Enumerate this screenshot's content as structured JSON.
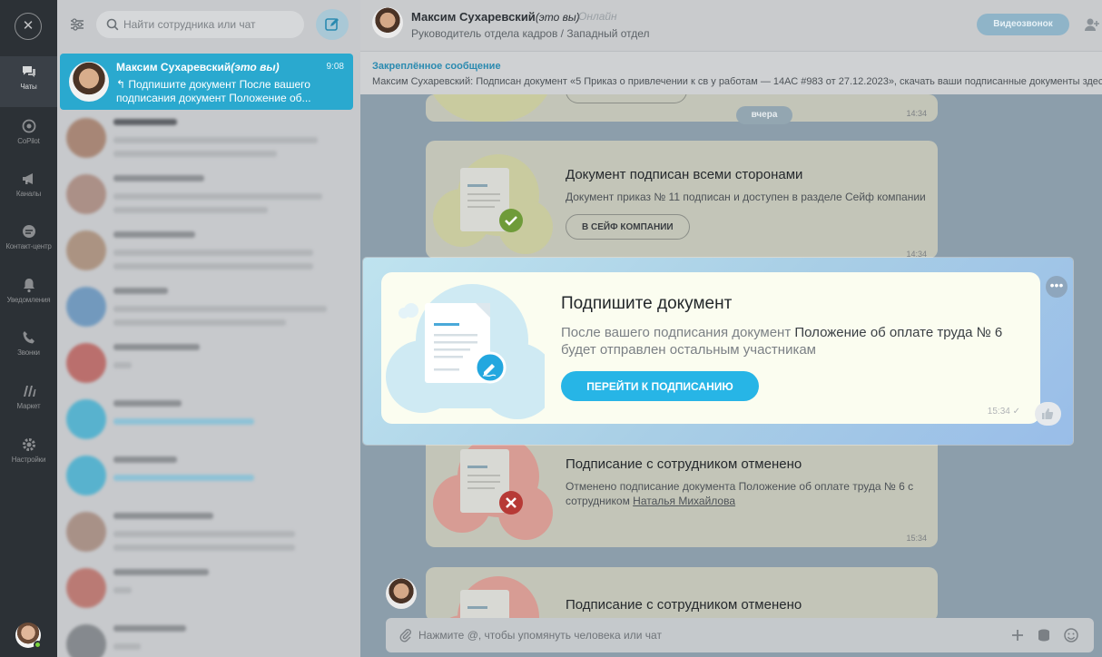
{
  "rail": {
    "items": [
      {
        "label": "Чаты",
        "icon": "chat-icon"
      },
      {
        "label": "CoPilot",
        "icon": "copilot-icon"
      },
      {
        "label": "Каналы",
        "icon": "megaphone-icon"
      },
      {
        "label": "Контакт-центр",
        "icon": "contact-center-icon"
      },
      {
        "label": "Уведомления",
        "icon": "bell-icon"
      },
      {
        "label": "Звонки",
        "icon": "phone-icon"
      },
      {
        "label": "Маркет",
        "icon": "market-icon"
      },
      {
        "label": "Настройки",
        "icon": "gear-icon"
      }
    ]
  },
  "list": {
    "search_placeholder": "Найти сотрудника или чат",
    "active_chat": {
      "name": "Максим Сухаревский",
      "name_suffix": "(это вы)",
      "time": "9:08",
      "preview": "↰ Подпишите документ После вашего подписания документ Положение об..."
    }
  },
  "header": {
    "name": "Максим Сухаревский",
    "name_suffix": "(это вы)",
    "status": "Онлайн",
    "subtitle": "Руководитель отдела кадров / Западный отдел",
    "video_button": "Видеозвонок"
  },
  "pinned": {
    "title": "Закреплённое сообщение",
    "text": "Максим Сухаревский: Подписан документ «5 Приказ о привлечении к св у работам — 14АС #983 от 27.12.2023», скачать ваши подписанные документы здесь"
  },
  "messages": {
    "day_separator": "вчера",
    "time_top": "14:34",
    "signed": {
      "title": "Документ подписан всеми сторонами",
      "text": "Документ приказ № 11 подписан и доступен в разделе Сейф компании",
      "button": "В СЕЙФ КОМПАНИИ",
      "time": "14:34"
    },
    "cancelled": {
      "title": "Подписание с сотрудником отменено",
      "text_before": "Отменено подписание документа Положение об оплате труда № 6 с сотрудником ",
      "person": "Наталья Михайлова",
      "time": "15:34"
    },
    "cancelled_2": {
      "title": "Подписание с сотрудником отменено"
    }
  },
  "spotlight": {
    "title": "Подпишите документ",
    "desc_part1": "После вашего подписания документ ",
    "desc_doc": "Положение об оплате труда № 6",
    "desc_part2": " будет отправлен остальным участникам",
    "button": "ПЕРЕЙТИ К ПОДПИСАНИЮ",
    "time": "15:34"
  },
  "composer": {
    "placeholder": "Нажмите @, чтобы упомянуть человека или чат"
  },
  "colors": {
    "accent": "#27b5e6",
    "active_chat": "#2aa9cf",
    "rail": "#2c3136"
  }
}
